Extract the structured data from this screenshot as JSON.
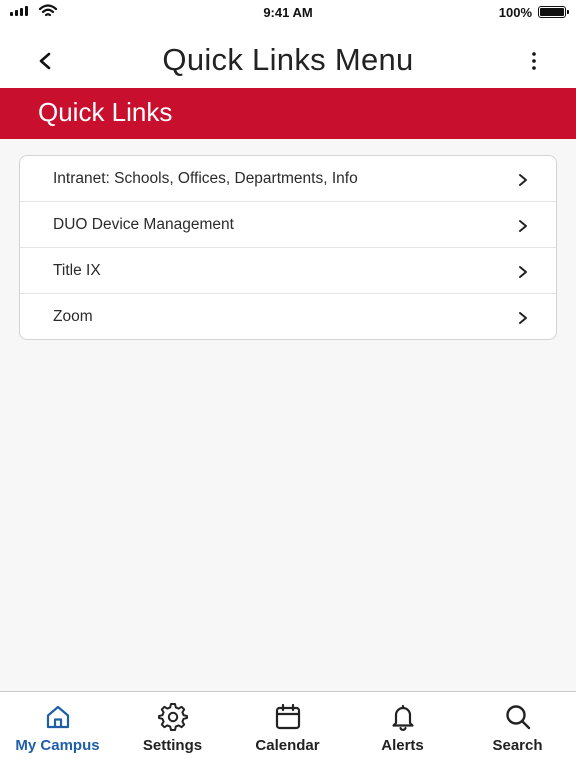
{
  "status_bar": {
    "time": "9:41 AM",
    "battery": "100%"
  },
  "header": {
    "title": "Quick Links Menu",
    "back_icon": "chevron-left-icon",
    "more_icon": "more-vertical-icon"
  },
  "banner": {
    "title": "Quick Links",
    "color": "#c8102e"
  },
  "links": [
    {
      "label": "Intranet: Schools, Offices, Departments, Info"
    },
    {
      "label": "DUO Device Management"
    },
    {
      "label": "Title IX"
    },
    {
      "label": "Zoom"
    }
  ],
  "tab_bar": {
    "active": "My Campus",
    "active_color": "#1f5fa8",
    "tabs": [
      {
        "label": "My Campus",
        "icon": "home-icon"
      },
      {
        "label": "Settings",
        "icon": "gear-icon"
      },
      {
        "label": "Calendar",
        "icon": "calendar-icon"
      },
      {
        "label": "Alerts",
        "icon": "bell-icon"
      },
      {
        "label": "Search",
        "icon": "search-icon"
      }
    ]
  }
}
